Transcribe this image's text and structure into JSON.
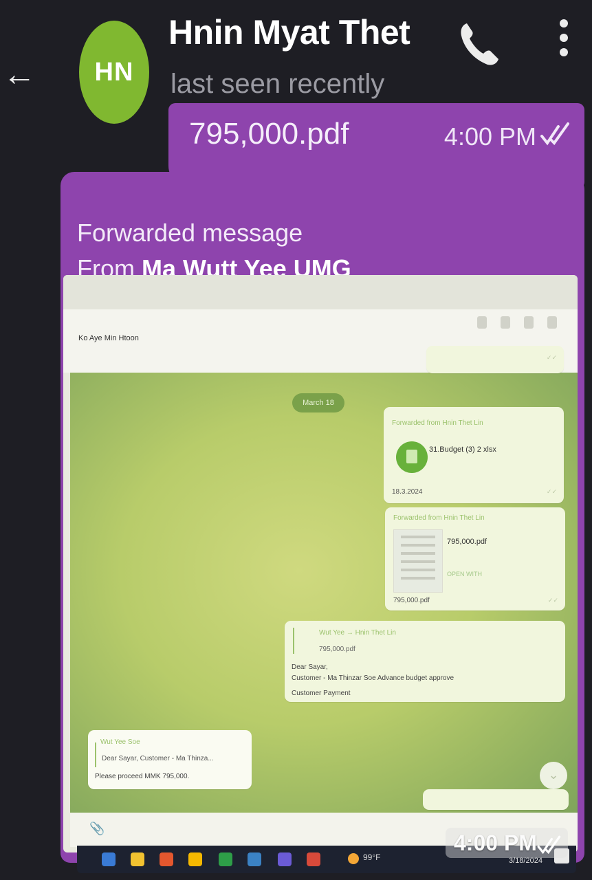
{
  "header": {
    "avatar_initials": "HN",
    "contact_name": "Hnin Myat Thet",
    "status": "last seen recently",
    "accent_color": "#80b830"
  },
  "outgoing_file": {
    "file_name": "795,000.pdf",
    "time": "4:00 PM",
    "bubble_color": "#8e44ad"
  },
  "forwarded": {
    "label": "Forwarded message",
    "from_prefix": "From",
    "from_name": "Ma Wutt Yee UMG",
    "time": "4:00 PM"
  },
  "screenshot": {
    "contact_name": "Ko Aye Min Htoon",
    "date_chip": "March 18",
    "messages": [
      {
        "forward_head": "Forwarded from Hnin Thet Lin",
        "file_name": "31.Budget (3) 2 xlsx",
        "caption": "18.3.2024"
      },
      {
        "forward_head": "Forwarded from Hnin Thet Lin",
        "file_name": "795,000.pdf",
        "action": "OPEN WITH",
        "caption": "795,000.pdf"
      },
      {
        "reply_head": "Wut Yee → Hnin Thet Lin",
        "reply_sub": "795,000.pdf",
        "line1": "Dear Sayar,",
        "line2": "Customer - Ma Thinzar Soe Advance budget approve",
        "line3": "Customer Payment"
      },
      {
        "reply_head": "Wut Yee Soe",
        "reply_sub": "Dear Sayar, Customer - Ma Thinza...",
        "body": "Please proceed MMK 795,000."
      }
    ]
  },
  "taskbar": {
    "weather": "99°F",
    "date": "3/18/2024"
  }
}
